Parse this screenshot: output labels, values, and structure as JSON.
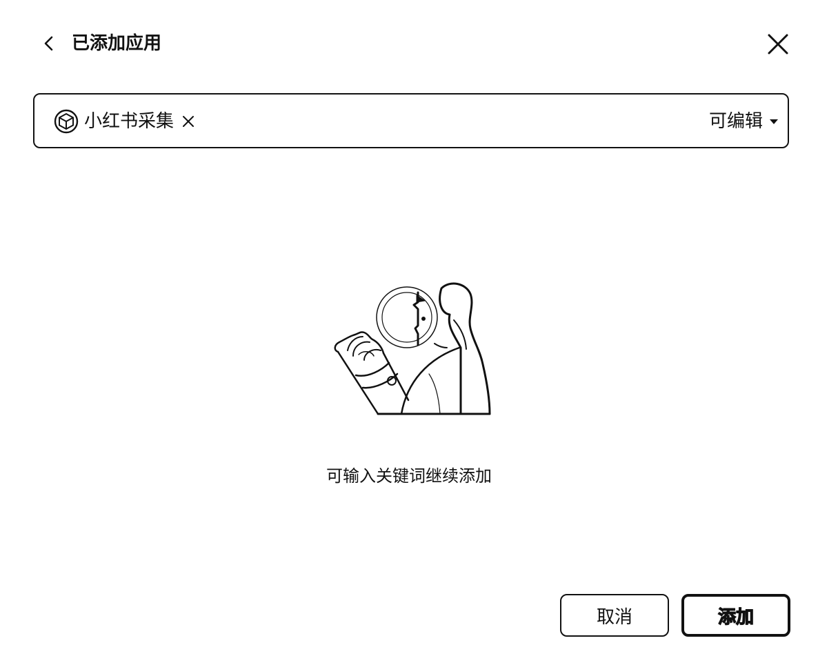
{
  "header": {
    "back_icon": "chevron-left-icon",
    "title": "已添加应用",
    "close_icon": "close-icon"
  },
  "selector": {
    "chip": {
      "icon": "app-cube-icon",
      "label": "小红书采集",
      "remove_icon": "close-small-icon"
    },
    "permission": {
      "label": "可编辑",
      "caret_icon": "caret-down-icon"
    }
  },
  "empty_state": {
    "illustration": "person-with-magnifier-illustration",
    "message": "可输入关键词继续添加"
  },
  "footer": {
    "cancel_label": "取消",
    "add_label": "添加"
  }
}
